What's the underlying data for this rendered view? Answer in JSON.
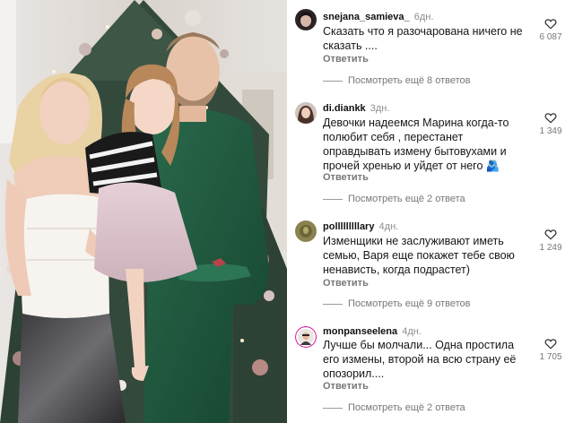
{
  "comments": [
    {
      "username": "snejana_samieva_",
      "time": "6дн.",
      "text": "Сказать что я разочарована ничего не сказать ....",
      "reply_label": "Ответить",
      "view_replies": "Посмотреть ещё 8 ответов",
      "likes": "6 087",
      "avatar": "avatar-dark-hair"
    },
    {
      "username": "di.diankk",
      "time": "3дн.",
      "text": "Девочки надеемся Марина когда-то полюбит себя , перестанет оправдывать измену бытовухами и прочей хренью и уйдет от него",
      "emoji": "🫂",
      "reply_label": "Ответить",
      "view_replies": "Посмотреть ещё 2 ответа",
      "likes": "1 349",
      "avatar": "avatar-woman"
    },
    {
      "username": "polllllllllary",
      "time": "4дн.",
      "text": "Изменщики не заслуживают иметь семью, Варя еще покажет тебе свою ненависть, когда подрастет)",
      "reply_label": "Ответить",
      "view_replies": "Посмотреть ещё 9 ответов",
      "likes": "1 249",
      "avatar": "avatar-olive"
    },
    {
      "username": "monpanseelena",
      "time": "4дн.",
      "text": "Лучше бы молчали... Одна простила его измены, второй на всю страну её опозорил....",
      "reply_label": "Ответить",
      "view_replies": "Посмотреть ещё 2 ответа",
      "likes": "1 705",
      "avatar": "avatar-story-ring"
    }
  ],
  "colors": {
    "username": "#111111",
    "secondary": "#8e8e8e",
    "suit_green": "#1f5a3f",
    "tree_green": "#2e4a3a"
  },
  "icons": {
    "like": "heart-outline-icon"
  }
}
